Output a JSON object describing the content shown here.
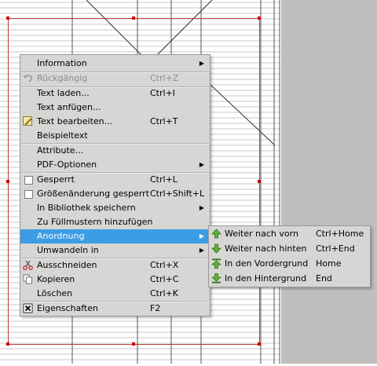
{
  "context_menu": {
    "items": [
      {
        "id": "information",
        "label": "Information",
        "submenu": true
      },
      {
        "id": "undo",
        "label": "Rückgängig",
        "shortcut": "Ctrl+Z",
        "disabled": true,
        "icon": "undo-icon"
      },
      {
        "id": "load-text",
        "label": "Text laden...",
        "shortcut": "Ctrl+I"
      },
      {
        "id": "append-text",
        "label": "Text anfügen..."
      },
      {
        "id": "edit-text",
        "label": "Text bearbeiten...",
        "shortcut": "Ctrl+T",
        "icon": "edit-pencil-icon"
      },
      {
        "id": "sample-text",
        "label": "Beispieltext"
      },
      {
        "id": "attributes",
        "label": "Attribute..."
      },
      {
        "id": "pdf-options",
        "label": "PDF-Optionen",
        "submenu": true
      },
      {
        "id": "locked",
        "label": "Gesperrt",
        "shortcut": "Ctrl+L",
        "checkbox": true
      },
      {
        "id": "size-locked",
        "label": "Größenänderung gesperrt",
        "shortcut": "Ctrl+Shift+L",
        "checkbox": true
      },
      {
        "id": "save-library",
        "label": "In Bibliothek speichern",
        "submenu": true
      },
      {
        "id": "add-pattern",
        "label": "Zu Füllmustern hinzufügen"
      },
      {
        "id": "arrange",
        "label": "Anordnung",
        "submenu": true,
        "highlighted": true
      },
      {
        "id": "convert-to",
        "label": "Umwandeln in",
        "submenu": true
      },
      {
        "id": "cut",
        "label": "Ausschneiden",
        "shortcut": "Ctrl+X",
        "icon": "scissors-icon"
      },
      {
        "id": "copy",
        "label": "Kopieren",
        "shortcut": "Ctrl+C",
        "icon": "copy-icon"
      },
      {
        "id": "delete",
        "label": "Löschen",
        "shortcut": "Ctrl+K"
      },
      {
        "id": "properties",
        "label": "Eigenschaften",
        "shortcut": "F2",
        "icon": "properties-icon"
      }
    ]
  },
  "arrange_submenu": {
    "items": [
      {
        "id": "raise",
        "label": "Weiter nach vorn",
        "shortcut": "Ctrl+Home",
        "icon": "raise-icon"
      },
      {
        "id": "lower",
        "label": "Weiter nach hinten",
        "shortcut": "Ctrl+End",
        "icon": "lower-icon"
      },
      {
        "id": "to-front",
        "label": "In den Vordergrund",
        "shortcut": "Home",
        "icon": "bring-to-front-icon"
      },
      {
        "id": "to-back",
        "label": "In den Hintergrund",
        "shortcut": "End",
        "icon": "send-to-back-icon"
      }
    ]
  },
  "colors": {
    "highlight": "#3c9ce4",
    "frame_border": "#c0393b",
    "handle": "#cc0000",
    "menu_bg": "#d7d6d4",
    "workspace": "#c0bebc",
    "icon_green": "#5bb531"
  }
}
